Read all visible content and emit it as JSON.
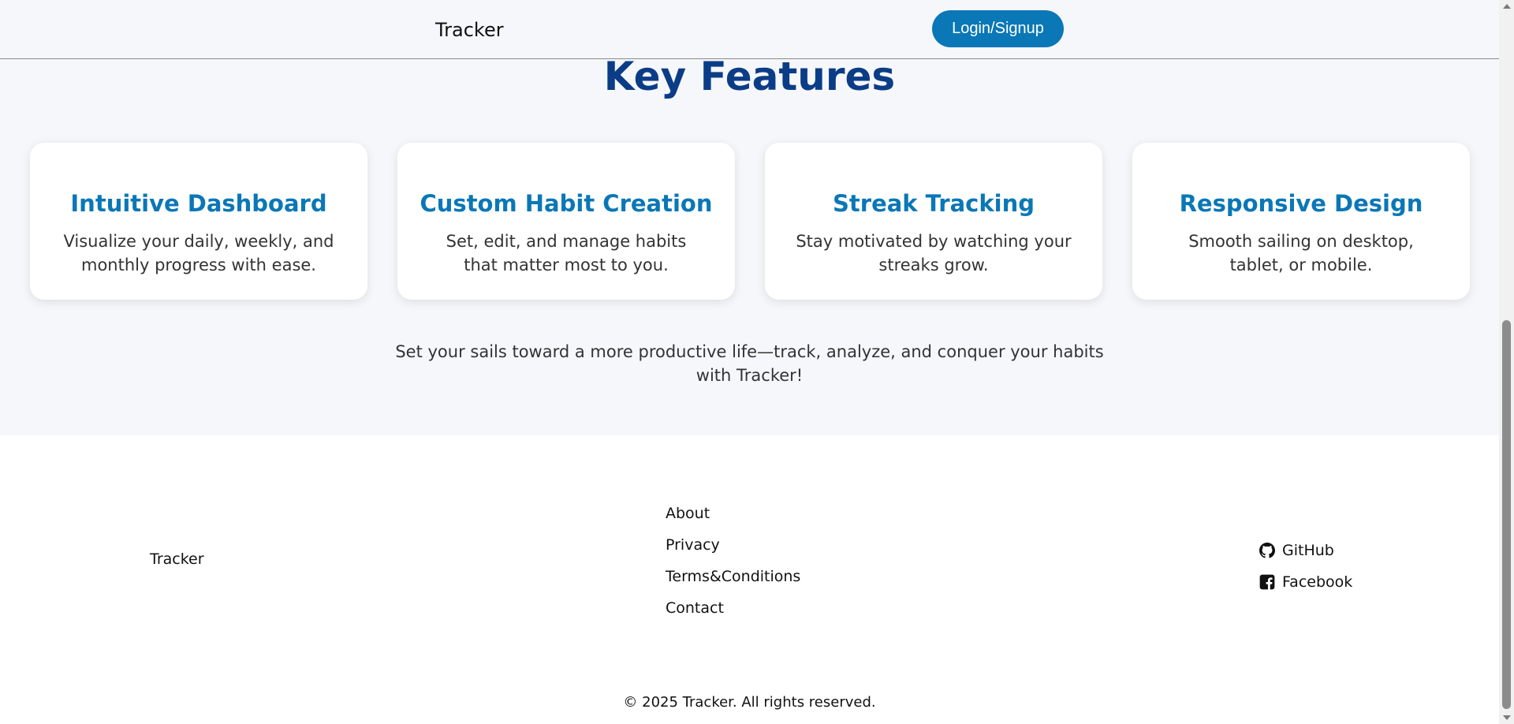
{
  "header": {
    "brand": "Tracker",
    "login_label": "Login/Signup"
  },
  "features": {
    "title": "Key Features",
    "cards": [
      {
        "title": "Intuitive Dashboard",
        "text": "Visualize your daily, weekly, and monthly progress with ease."
      },
      {
        "title": "Custom Habit Creation",
        "text": "Set, edit, and manage habits that matter most to you."
      },
      {
        "title": "Streak Tracking",
        "text": "Stay motivated by watching your streaks grow."
      },
      {
        "title": "Responsive Design",
        "text": "Smooth sailing on desktop, tablet, or mobile."
      }
    ],
    "tagline": "Set your sails toward a more productive life—track, analyze, and conquer your habits with Tracker!"
  },
  "footer": {
    "brand": "Tracker",
    "links": [
      "About",
      "Privacy",
      "Terms&Conditions",
      "Contact"
    ],
    "social": [
      {
        "label": "GitHub",
        "icon": "github-icon"
      },
      {
        "label": "Facebook",
        "icon": "facebook-icon"
      }
    ],
    "copyright": "© 2025 Tracker. All rights reserved."
  },
  "colors": {
    "accent": "#0a77b6",
    "heading": "#0b3d87",
    "background": "#f6f7fb"
  }
}
